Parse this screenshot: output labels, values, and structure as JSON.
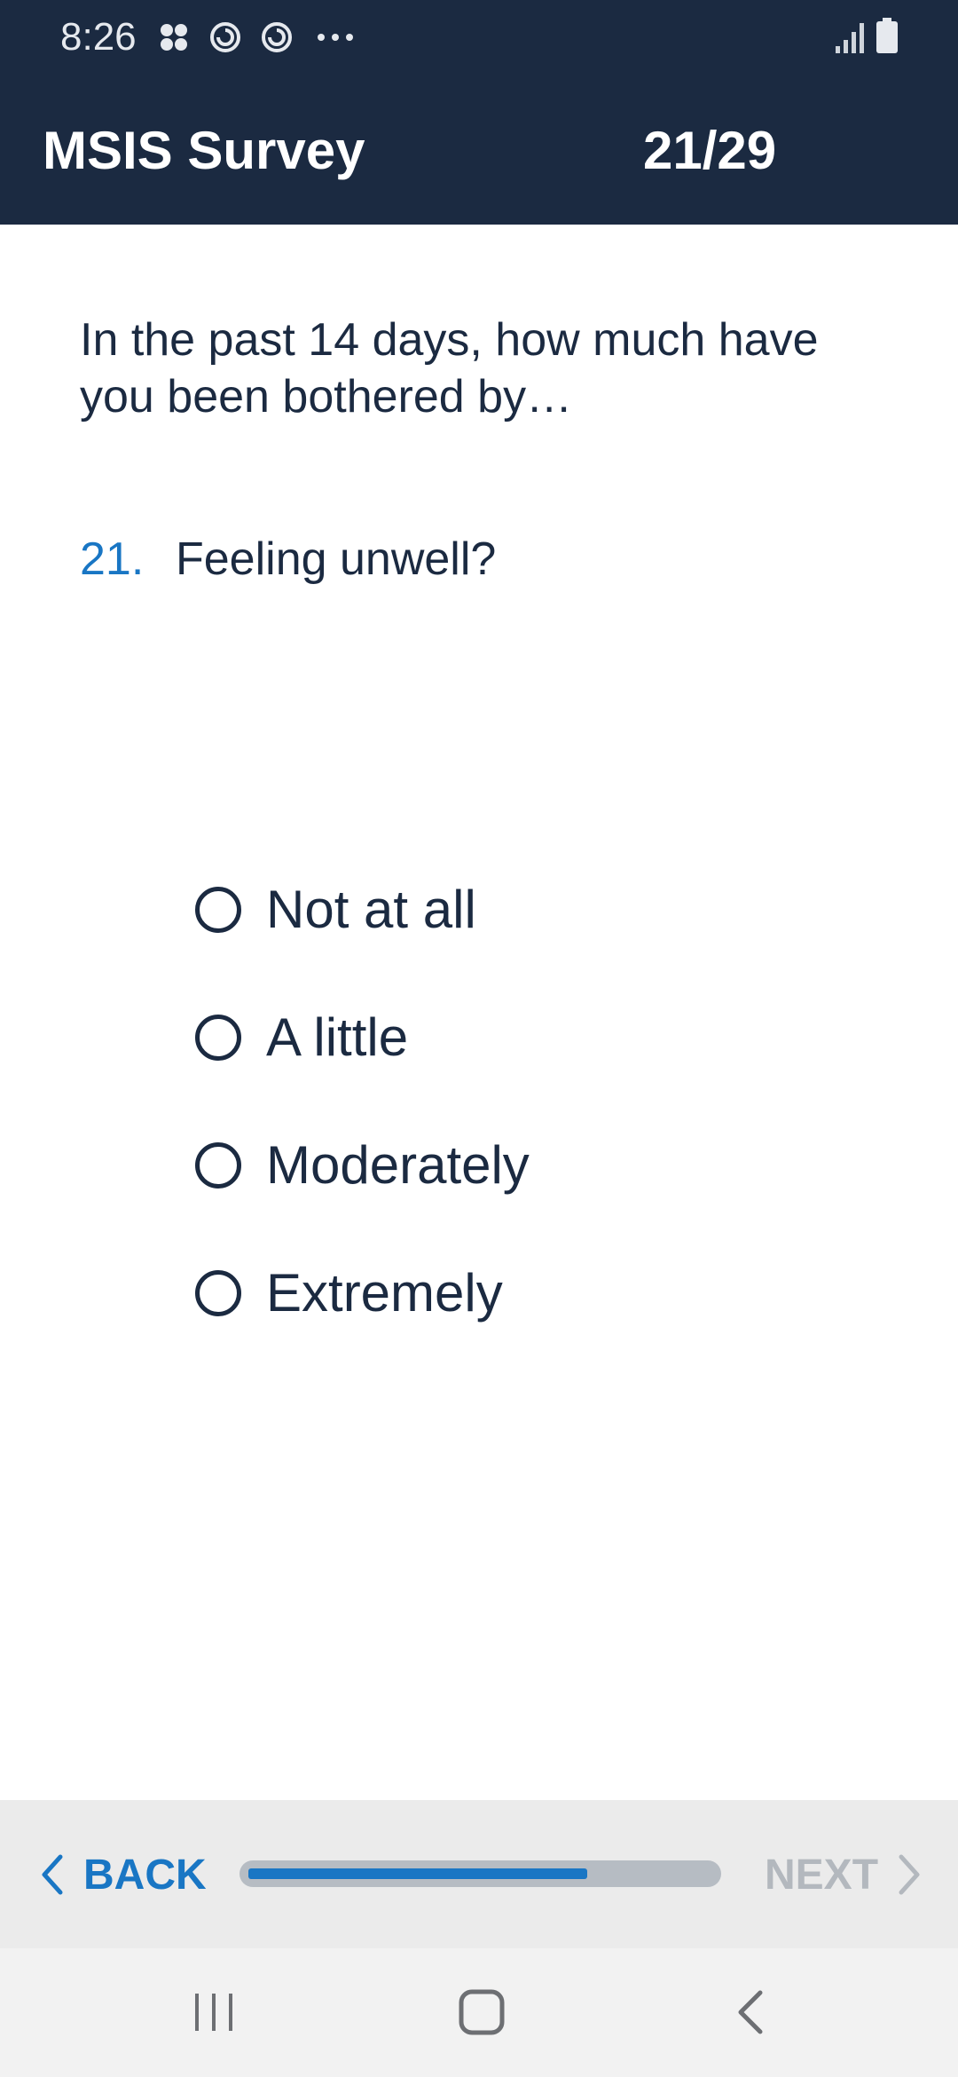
{
  "status_bar": {
    "time": "8:26",
    "icons": [
      "apps-grid-icon",
      "sync-icon",
      "sync-icon",
      "more-dots-icon"
    ],
    "right_icons": [
      "signal-icon",
      "battery-icon"
    ]
  },
  "header": {
    "title": "MSIS Survey",
    "counter": "21/29"
  },
  "question": {
    "intro": "In the past 14 days, how much have you been bothered by…",
    "number": "21.",
    "text": "Feeling unwell?",
    "options": [
      {
        "label": "Not at all",
        "selected": false
      },
      {
        "label": "A little",
        "selected": false
      },
      {
        "label": "Moderately",
        "selected": false
      },
      {
        "label": "Extremely",
        "selected": false
      }
    ]
  },
  "nav": {
    "back_label": "BACK",
    "next_label": "NEXT",
    "next_enabled": false,
    "progress": 0.73
  },
  "colors": {
    "header_bg": "#1b2a41",
    "accent": "#1976c4",
    "text": "#1b2a41",
    "disabled": "#b3b8be"
  },
  "system_nav": {
    "buttons": [
      "recent-apps-icon",
      "home-icon",
      "back-icon"
    ]
  }
}
